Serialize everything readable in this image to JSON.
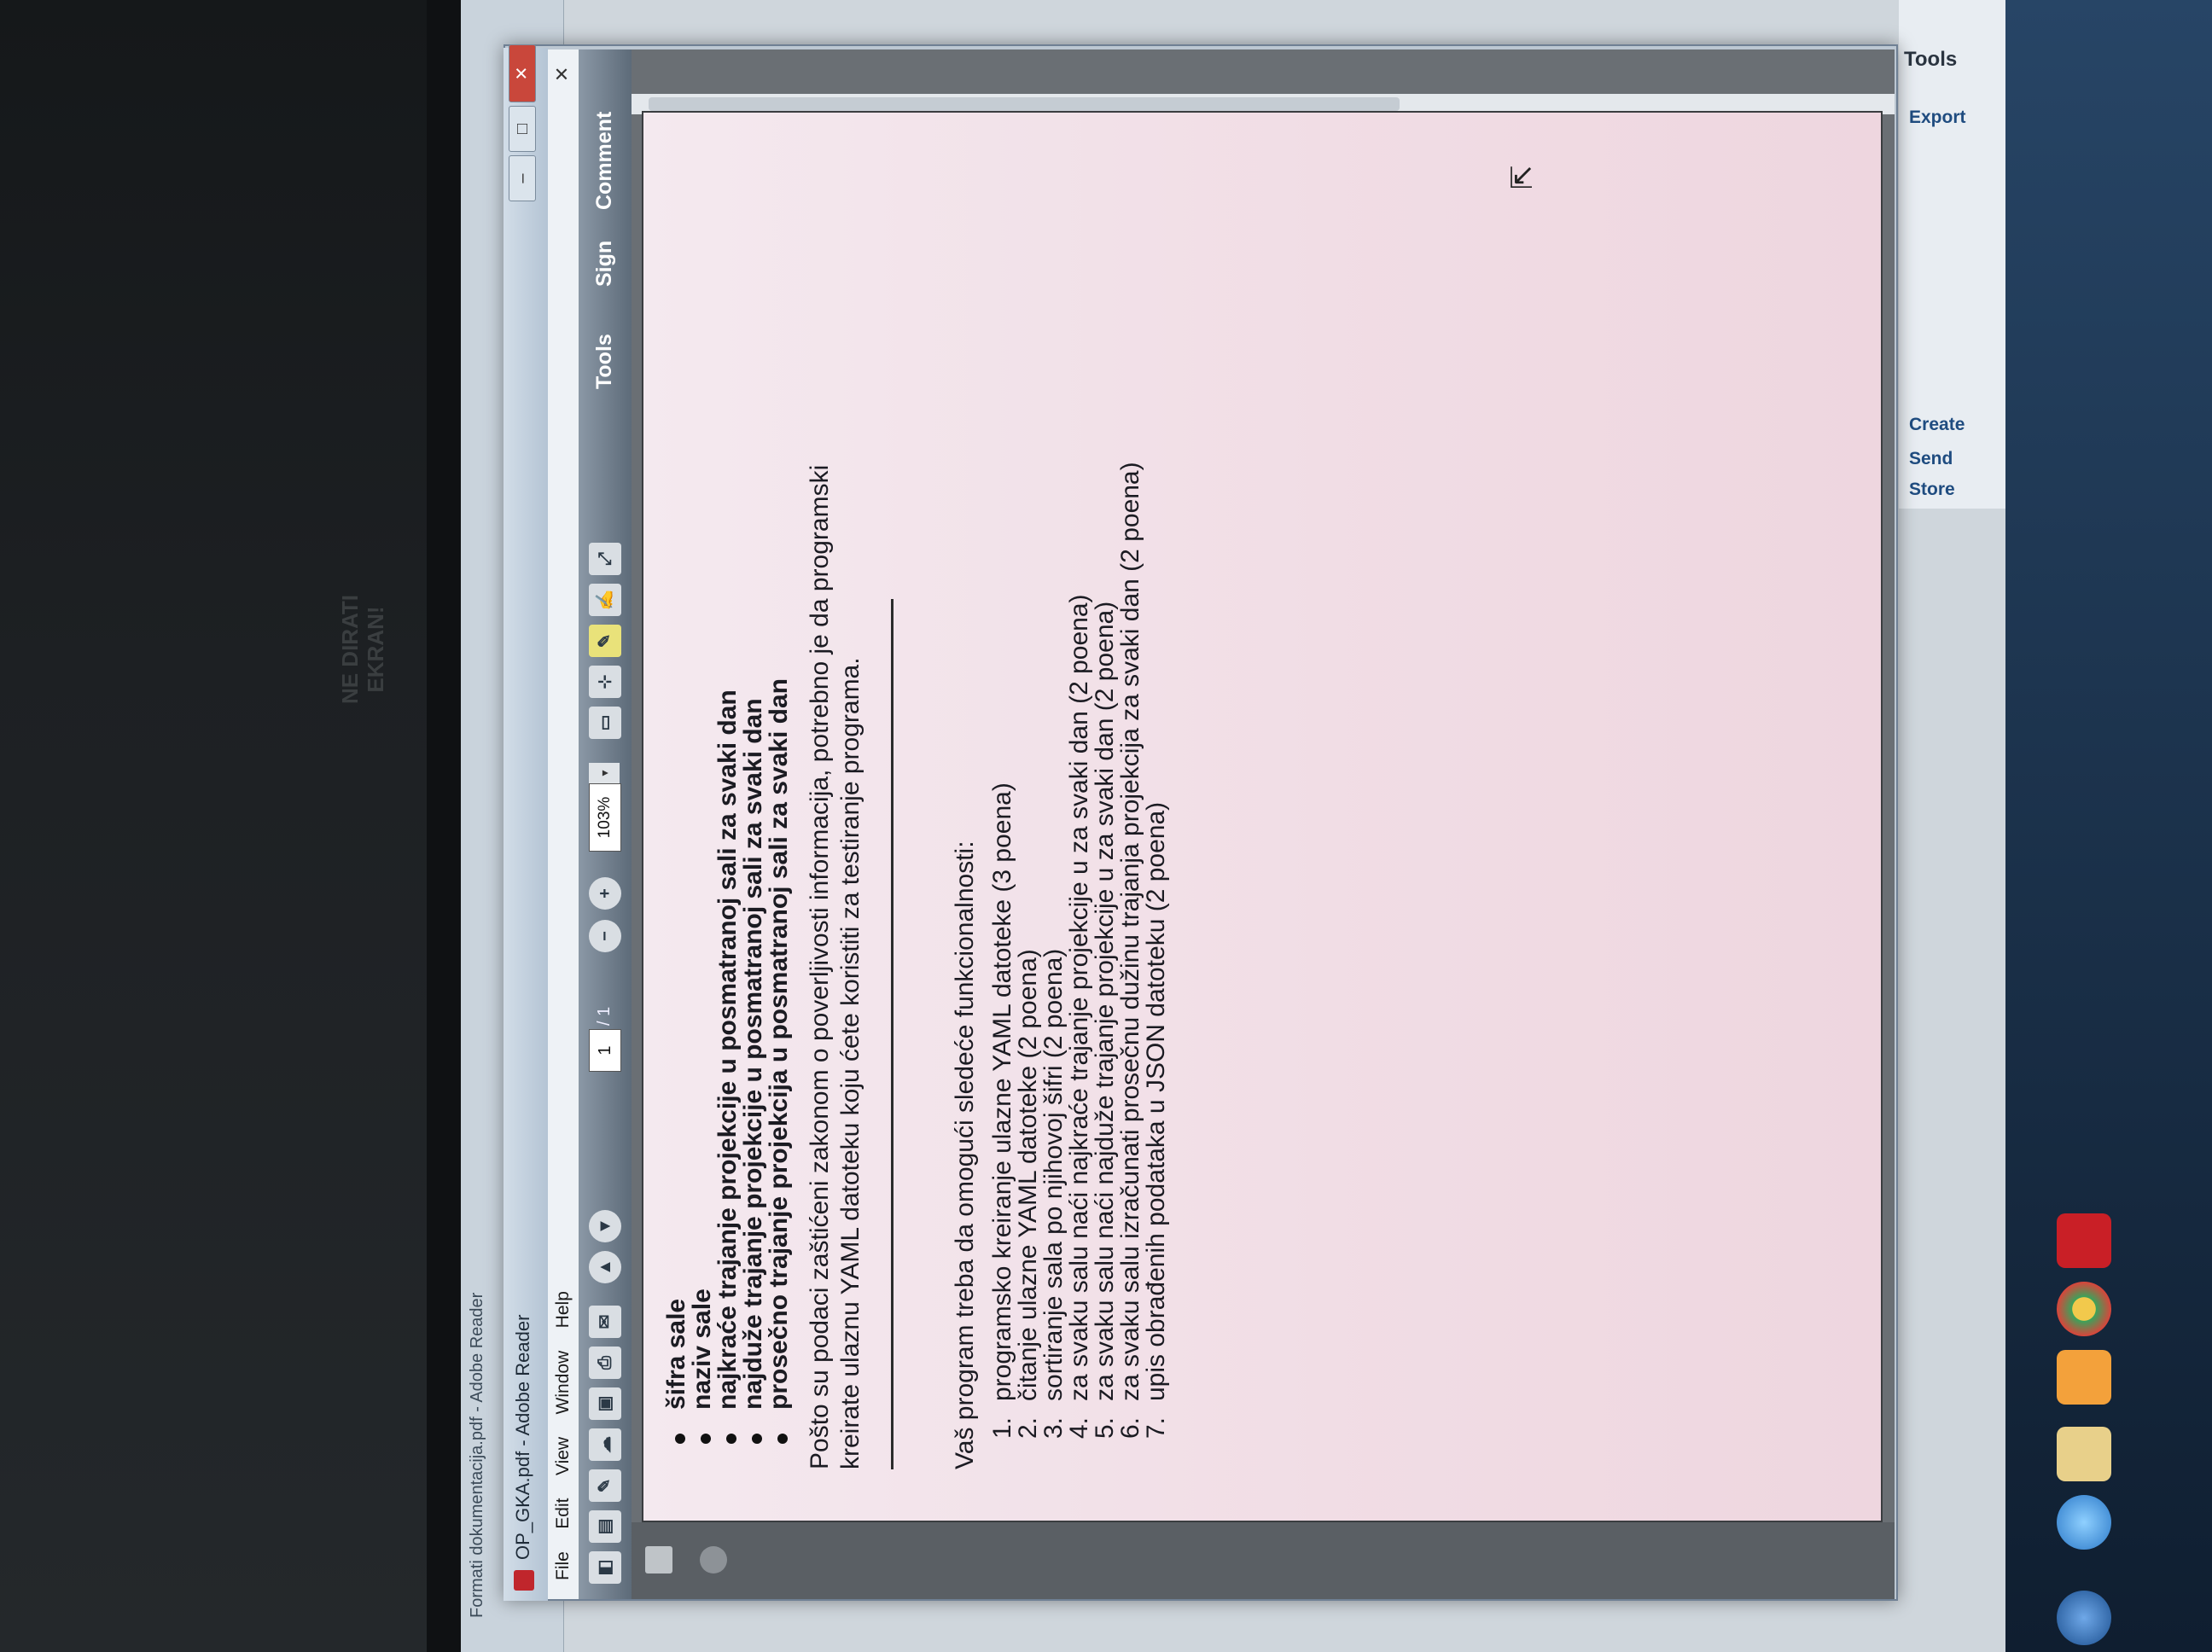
{
  "background_window": {
    "title": "Formati dokumentacija.pdf - Adobe Reader",
    "menu": [
      "File",
      "Edit",
      "View",
      "Window",
      "Help"
    ]
  },
  "window": {
    "title": "OP_GKA.pdf - Adobe Reader",
    "controls": {
      "minimize": "–",
      "maximize": "□",
      "close": "✕"
    }
  },
  "menu": {
    "items": [
      "File",
      "Edit",
      "View",
      "Window",
      "Help"
    ],
    "close_doc": "✕"
  },
  "toolbar": {
    "page_current": "1",
    "page_total": "/ 1",
    "zoom": "103%",
    "zoom_dropdown": "▾",
    "zoom_out": "−",
    "zoom_in": "+",
    "right_buttons": [
      "Tools",
      "Sign",
      "Comment"
    ]
  },
  "sticker": {
    "text": "NE DIRATI EKRAN!"
  },
  "document": {
    "bullets": [
      "šifra sale",
      "naziv sale",
      "najkraće trajanje projekcije u posmatranoj sali za svaki dan",
      "najduže trajanje projekcije u posmatranoj sali za svaki dan",
      "prosečno trajanje projekcija u posmatranoj sali za svaki dan"
    ],
    "paragraph_line1": "Pošto su podaci zaštićeni zakonom o poverljivosti informacija, potrebno je da programski",
    "paragraph_line2": "kreirate ulaznu YAML datoteku koju ćete koristiti za testiranje programa.",
    "intro": "Vaš program treba da omogući sledeće funkcionalnosti:",
    "list": [
      {
        "num": "1.",
        "text": "programsko kreiranje ulazne YAML datoteke (3 poena)"
      },
      {
        "num": "2.",
        "text": "čitanje ulazne YAML datoteke (2 poena)"
      },
      {
        "num": "3.",
        "text": "sortiranje sala po njihovoj šifri (2 poena)"
      },
      {
        "num": "4.",
        "text": "za svaku salu naći najkraće trajanje projekcije u za svaki dan (2 poena)"
      },
      {
        "num": "5.",
        "text": "za svaku salu naći najduže trajanje projekcije u za svaki dan (2 poena)"
      },
      {
        "num": "6.",
        "text": "za svaku salu izračunati prosečnu dužinu trajanja projekcija za svaki dan (2 poena)"
      },
      {
        "num": "7.",
        "text": "upis obrađenih podataka u JSON datoteku (2 poena)"
      }
    ]
  },
  "tools_pane": {
    "title": "Tools",
    "items": [
      "Export",
      "Create",
      "Send",
      "Store"
    ]
  },
  "colors": {
    "page_tint": "#f1dde5",
    "toolbar": "#6b7987",
    "titlebar": "#c3d2e0",
    "close_button": "#c9473b"
  },
  "icons": [
    "pdf-app-icon",
    "print-icon",
    "email-icon",
    "prev-page-icon",
    "next-page-icon",
    "zoom-out-icon",
    "zoom-in-icon",
    "select-icon",
    "comment-icon",
    "sign-icon",
    "fullscreen-icon",
    "chrome-icon",
    "ie-icon",
    "acrobat-icon"
  ]
}
